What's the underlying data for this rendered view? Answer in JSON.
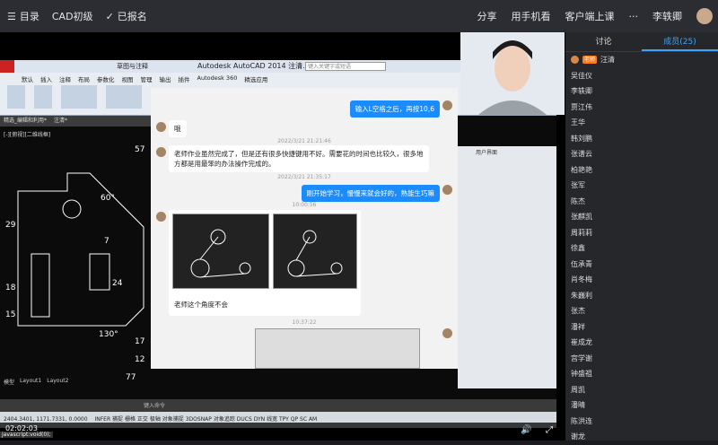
{
  "topbar": {
    "catalog_label": "目录",
    "course_title": "CAD初级",
    "enrolled_label": "已报名",
    "share_label": "分享",
    "mobile_label": "用手机看",
    "client_label": "客户端上课",
    "more_label": "···",
    "username": "李轶卿"
  },
  "cad_window": {
    "title": "Autodesk AutoCAD 2014    注清.dwg",
    "search_placeholder": "键入关键字或短语",
    "ribbon_tabs": [
      "默认",
      "插入",
      "注释",
      "布局",
      "参数化",
      "视图",
      "管理",
      "输出",
      "插件",
      "Autodesk 360",
      "精选应用"
    ],
    "ribbon_group_label": "草图与注释",
    "doc_tabs": [
      "精选_编辑和利用*",
      "注清*"
    ],
    "drawing_title": "[-][俯视][二维线框]",
    "layout_tabs": [
      "模型",
      "Layout1",
      "Layout2"
    ],
    "cmd_placeholder": "键入命令",
    "status_coords": "2404.3401, 1171.7331, 0.0000",
    "status_items": [
      "INFER",
      "捕捉",
      "栅格",
      "正交",
      "极轴",
      "对象捕捉",
      "3DOSNAP",
      "对象追踪",
      "DUCS",
      "DYN",
      "线宽",
      "TPY",
      "QP",
      "SC",
      "AM"
    ],
    "dims": [
      "57",
      "60°",
      "29",
      "7",
      "18",
      "24",
      "15",
      "130°",
      "17",
      "12",
      "77"
    ],
    "right_panel_label": "用户界面"
  },
  "chat": {
    "messages": [
      {
        "side": "right",
        "text": "输入L空格之后，再按10,6"
      },
      {
        "side": "left",
        "text": "哦"
      },
      {
        "side": "ts",
        "text": "2022/3/21 21:21:46"
      },
      {
        "side": "left",
        "text": "老师作业虽然完成了，但是还有很多快捷键用不好。需要花的时间也比较久，很多地方都是用最笨的办法操作完成的。"
      },
      {
        "side": "ts",
        "text": "2022/3/21 21:35:17"
      },
      {
        "side": "right",
        "text": "刚开始学习，慢慢来就会好的，熟能生巧嘛"
      },
      {
        "side": "ts",
        "text": "10:00:56"
      },
      {
        "side": "left",
        "text": "老师这个角度不会"
      },
      {
        "side": "ts",
        "text": "10:37:22"
      }
    ]
  },
  "video": {
    "time": "02:02:03",
    "status_text": "javascript:void(0);"
  },
  "sidebar": {
    "tab_discuss": "讨论",
    "tab_members": "成员(25)",
    "teacher_badge": "老师",
    "members": [
      "汪清",
      "吴佳仪",
      "李轶卿",
      "贾江伟",
      "王华",
      "韩刘鹏",
      "张谱云",
      "柏艳艳",
      "张军",
      "陈杰",
      "张麒凯",
      "周莉莉",
      "徐鑫",
      "伍承青",
      "肖冬梅",
      "朱巍利",
      "张杰",
      "潘祥",
      "崔成龙",
      "宫学谢",
      "钟盛祖",
      "周凯",
      "潘晴",
      "陈洪连",
      "谢龙"
    ]
  },
  "colors": {
    "accent": "#3ea2ff",
    "chat_bubble": "#1a8cff",
    "teacher_badge": "#ff7a1a"
  }
}
